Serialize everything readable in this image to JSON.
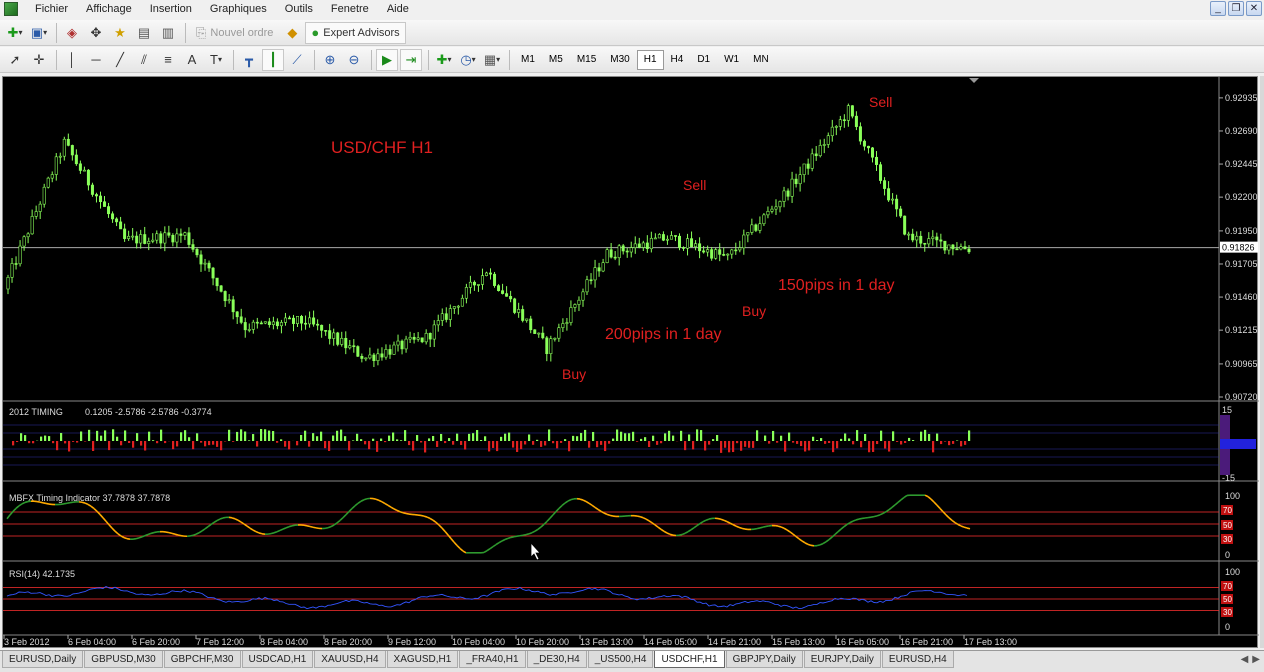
{
  "menu": [
    "Fichier",
    "Affichage",
    "Insertion",
    "Graphiques",
    "Outils",
    "Fenetre",
    "Aide"
  ],
  "toolbar1": {
    "new_order": "Nouvel ordre",
    "expert_advisors": "Expert Advisors"
  },
  "timeframes": [
    "M1",
    "M5",
    "M15",
    "M30",
    "H1",
    "H4",
    "D1",
    "W1",
    "MN"
  ],
  "active_timeframe": "H1",
  "main_chart": {
    "title": "USD/CHF  H1",
    "current_price": "0.91826",
    "price_ticks": [
      "0.92935",
      "0.92690",
      "0.92445",
      "0.92200",
      "0.91950",
      "0.91705",
      "0.91460",
      "0.91215",
      "0.90965",
      "0.90720"
    ],
    "annotations": {
      "sell1": "Sell",
      "sell2": "Sell",
      "buy1": "Buy",
      "buy2": "Buy",
      "pips1": "200pips in 1 day",
      "pips2": "150pips in 1 day"
    }
  },
  "timing_panel": {
    "label": "2012 TIMING",
    "values": "0.1205 -2.5786 -2.5786 -0.3774",
    "top_tick": "15",
    "bottom_tick": "-15"
  },
  "mbfx_panel": {
    "label": "MBFX Timing Indicator 37.7878 37.7878",
    "ticks": [
      "100",
      "0"
    ],
    "levels": [
      "70",
      "50",
      "30"
    ]
  },
  "rsi_panel": {
    "label": "RSI(14) 42.1735",
    "ticks": [
      "100",
      "0"
    ],
    "levels": [
      "70",
      "50",
      "30"
    ]
  },
  "time_axis": [
    "3 Feb 2012",
    "6 Feb 04:00",
    "6 Feb 20:00",
    "7 Feb 12:00",
    "8 Feb 04:00",
    "8 Feb 20:00",
    "9 Feb 12:00",
    "10 Feb 04:00",
    "10 Feb 20:00",
    "13 Feb 13:00",
    "14 Feb 05:00",
    "14 Feb 21:00",
    "15 Feb 13:00",
    "16 Feb 05:00",
    "16 Feb 21:00",
    "17 Feb 13:00"
  ],
  "symbol_tabs": [
    "EURUSD,Daily",
    "GBPUSD,M30",
    "GBPCHF,M30",
    "USDCAD,H1",
    "XAUUSD,H4",
    "XAGUSD,H1",
    "_FRA40,H1",
    "_DE30,H4",
    "_US500,H4",
    "USDCHF,H1",
    "GBPJPY,Daily",
    "EURJPY,Daily",
    "EURUSD,H4"
  ],
  "active_symbol_tab": "USDCHF,H1",
  "colors": {
    "candle": "#8aff5a",
    "annot": "#e02020",
    "level": "#ff3030",
    "rsi": "#3355ff",
    "osc_up": "#2e9a2e",
    "osc_down": "#ffaa00"
  },
  "chart_data": {
    "type": "line",
    "title": "USD/CHF  H1",
    "ylim": [
      0.9072,
      0.9306
    ],
    "x": [
      "3 Feb 2012",
      "6 Feb 04:00",
      "6 Feb 20:00",
      "7 Feb 12:00",
      "8 Feb 04:00",
      "8 Feb 20:00",
      "9 Feb 12:00",
      "10 Feb 04:00",
      "10 Feb 20:00",
      "13 Feb 13:00",
      "14 Feb 05:00",
      "14 Feb 21:00",
      "15 Feb 13:00",
      "16 Feb 05:00",
      "16 Feb 21:00",
      "17 Feb 13:00"
    ],
    "series": [
      {
        "values": [
          0.9152,
          0.926,
          0.9188,
          0.9192,
          0.9124,
          0.9128,
          0.9101,
          0.9116,
          0.9166,
          0.9108,
          0.9178,
          0.919,
          0.9175,
          0.9225,
          0.9284,
          0.919,
          0.9182
        ]
      }
    ]
  }
}
